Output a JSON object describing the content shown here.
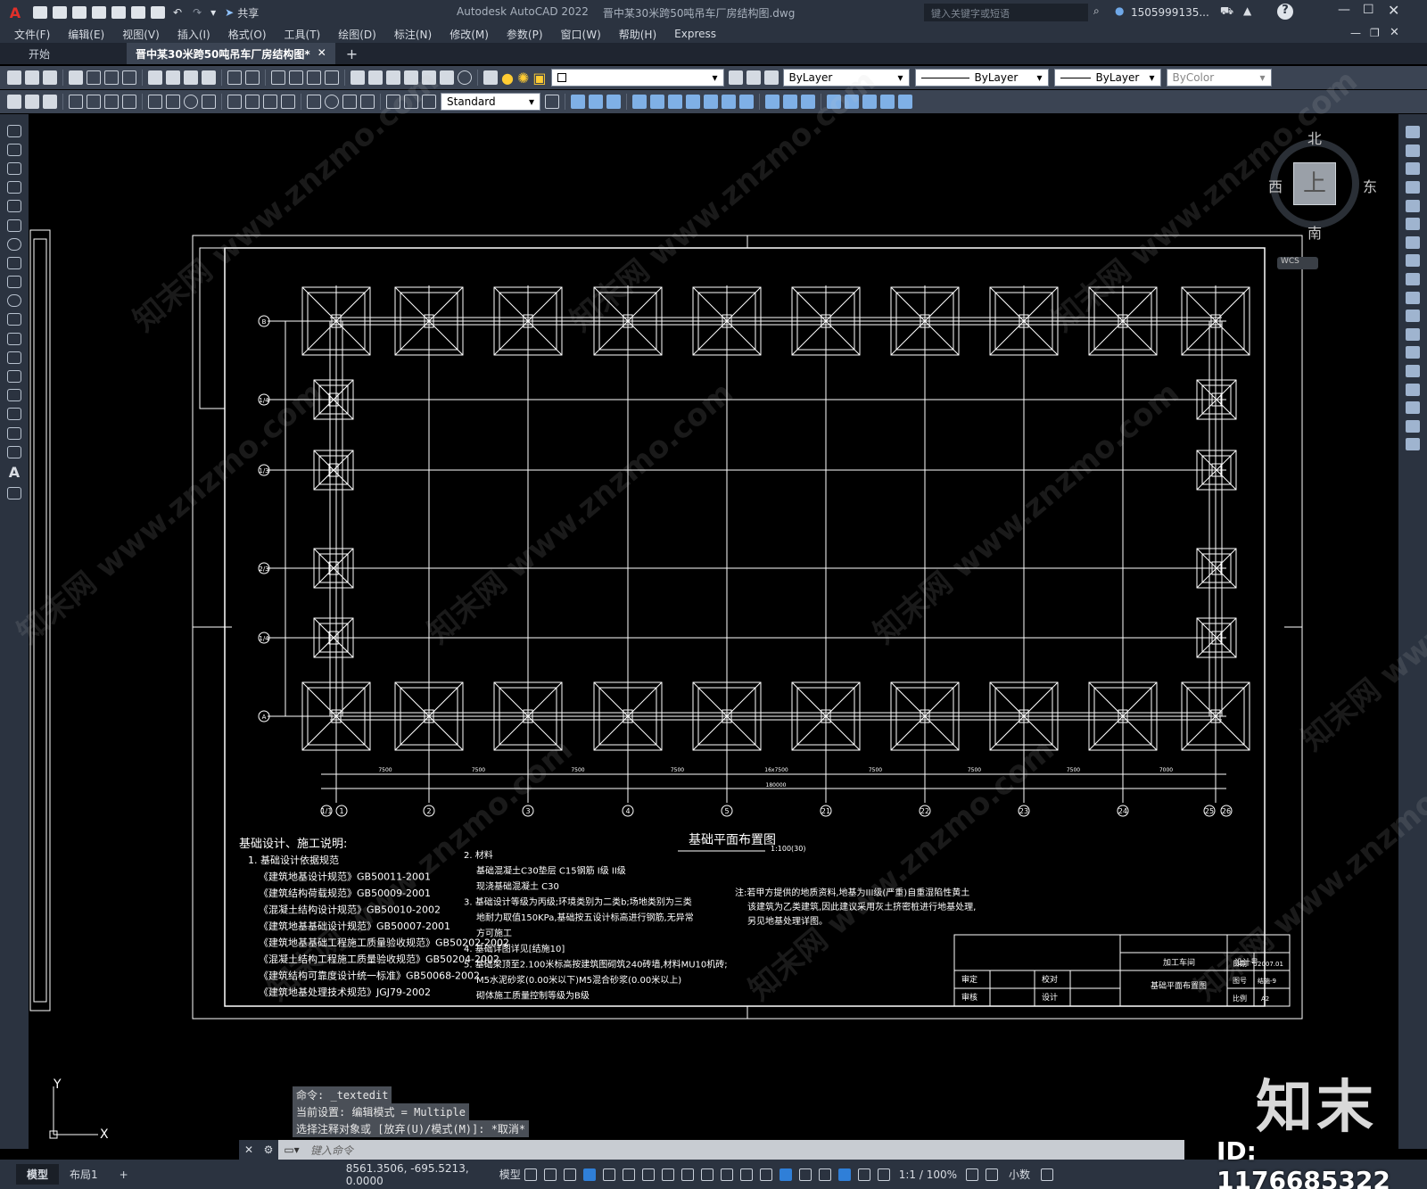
{
  "app": {
    "name": "Autodesk AutoCAD 2022",
    "file": "晋中某30米跨50吨吊车厂房结构图.dwg"
  },
  "titlebar": {
    "share": "共享",
    "search_placeholder": "键入关键字或短语",
    "user": "1505999135...",
    "app_letter": "A"
  },
  "menu": [
    "文件(F)",
    "编辑(E)",
    "视图(V)",
    "插入(I)",
    "格式(O)",
    "工具(T)",
    "绘图(D)",
    "标注(N)",
    "修改(M)",
    "参数(P)",
    "窗口(W)",
    "帮助(H)",
    "Express"
  ],
  "tabs": {
    "start": "开始",
    "active": "晋中某30米跨50吨吊车厂房结构图*",
    "add": "+"
  },
  "toolbar": {
    "layer_color": "ByLayer",
    "linetype": "ByLayer",
    "lineweight": "ByLayer",
    "plotstyle": "ByColor",
    "textstyle": "Standard"
  },
  "viewcube": {
    "north": "北",
    "south": "南",
    "east": "东",
    "west": "西",
    "top": "上",
    "wcs": "WCS"
  },
  "ucs": {
    "x": "X",
    "y": "Y"
  },
  "drawing": {
    "axes_top": [
      "B",
      "1/4",
      "1/3",
      "2/3",
      "1/4",
      "A"
    ],
    "axes_bottom": [
      "1/1",
      "1",
      "2",
      "3",
      "4",
      "5",
      "21",
      "22",
      "23",
      "24",
      "25",
      "26"
    ],
    "dim_total": "180000",
    "dim_spans": [
      "7500",
      "7500",
      "7500",
      "7500",
      "16x7500",
      "7500",
      "7500",
      "7500",
      "7000"
    ],
    "plan_title": "基础平面布置图",
    "plan_scale": "1:100(30)",
    "notes_title": "基础设计、施工说明:",
    "notes_left": [
      "1. 基础设计依据规范",
      "《建筑地基设计规范》GB50011-2001",
      "《建筑结构荷载规范》GB50009-2001",
      "《混凝土结构设计规范》GB50010-2002",
      "《建筑地基基础设计规范》GB50007-2001",
      "《建筑地基基础工程施工质量验收规范》GB50202-2002",
      "《混凝土结构工程施工质量验收规范》GB50204-2002",
      "《建筑结构可靠度设计统一标准》GB50068-2002",
      "《建筑地基处理技术规范》JGJ79-2002"
    ],
    "notes_mid": [
      "2. 材料",
      "基础混凝土C30垫层 C15钢筋 I级 II级",
      "现浇基础混凝土 C30",
      "3. 基础设计等级为丙级;环境类别为二类b;场地类别为三类",
      "地耐力取值150KPa,基础按五设计标高进行钢筋,无异常",
      "方可施工",
      "4. 基础详图详见[结施10]",
      "5. 基础梁顶至2.100米标高按建筑图砌筑240砖墙,材料MU10机砖;",
      "M5水泥砂浆(0.00米以下)M5混合砂浆(0.00米以上)",
      "砌体施工质量控制等级为B级"
    ],
    "notes_right": [
      "注:若甲方提供的地质资料,地基为III级(严重)自重湿陷性黄土",
      "该建筑为乙类建筑,因此建议采用灰土挤密桩进行地基处理,",
      "另见地基处理详图。"
    ],
    "title_block": {
      "company": "加工车间",
      "design_no_label": "设计号",
      "drawing_name": "基础平面布置图",
      "rows_left": [
        "审定",
        "审核"
      ],
      "rows_mid": [
        "校对",
        "设计"
      ],
      "rows_right_labels": [
        "日期",
        "图号",
        "比例"
      ],
      "rows_right_values": [
        "2007.01",
        "结施-9",
        "A2"
      ]
    }
  },
  "command": {
    "history": [
      "命令: _textedit",
      "当前设置: 编辑模式 = Multiple",
      "选择注释对象或 [放弃(U)/模式(M)]: *取消*"
    ],
    "placeholder": "键入命令"
  },
  "status": {
    "tab_model": "模型",
    "tab_layout": "布局1",
    "coords": "8561.3506, -695.5213, 0.0000",
    "model_btn": "模型",
    "scale": "1:1 / 100%",
    "units": "小数"
  },
  "overlay": {
    "brand": "知末",
    "id": "ID: 1176685322",
    "watermark": "知末网 www.znzmo.com"
  }
}
